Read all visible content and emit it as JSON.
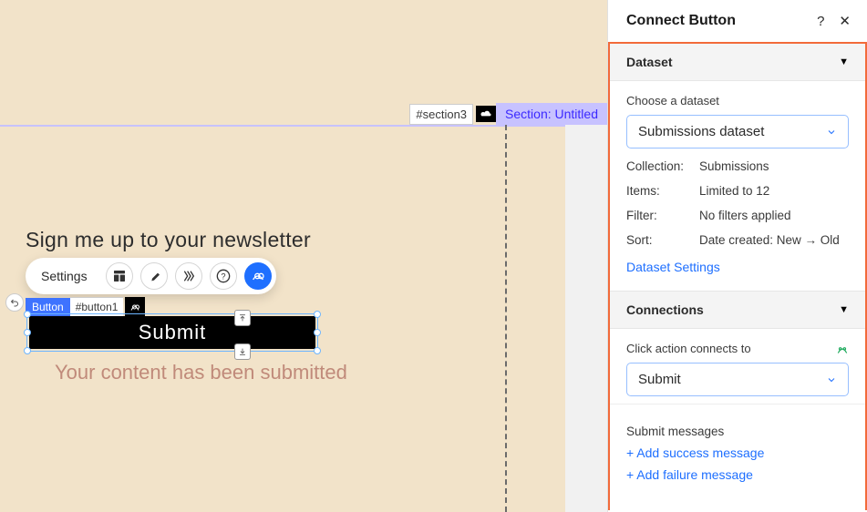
{
  "canvas": {
    "section_tag": "Section: Untitled",
    "section_id": "#section3",
    "newsletter_heading": "Sign me up to your newsletter",
    "toolbar_settings": "Settings",
    "element_tag": "Button",
    "element_id": "#button1",
    "submit_button_text": "Submit",
    "submitted_message": "Your content has been submitted"
  },
  "sidebar": {
    "panel_title": "Connect Button",
    "help_label": "?",
    "close_label": "✕",
    "dataset": {
      "title": "Dataset",
      "choose_label": "Choose a dataset",
      "selected": "Submissions dataset",
      "collection_key": "Collection:",
      "collection_val": "Submissions",
      "items_key": "Items:",
      "items_val": "Limited to 12",
      "filter_key": "Filter:",
      "filter_val": "No filters applied",
      "sort_key": "Sort:",
      "sort_val": "Date created: New → Old",
      "settings_link": "Dataset Settings"
    },
    "connections": {
      "title": "Connections",
      "click_label": "Click action connects to",
      "selected": "Submit",
      "submit_msgs_label": "Submit messages",
      "add_success": "+ Add success message",
      "add_failure": "+ Add failure message"
    }
  }
}
